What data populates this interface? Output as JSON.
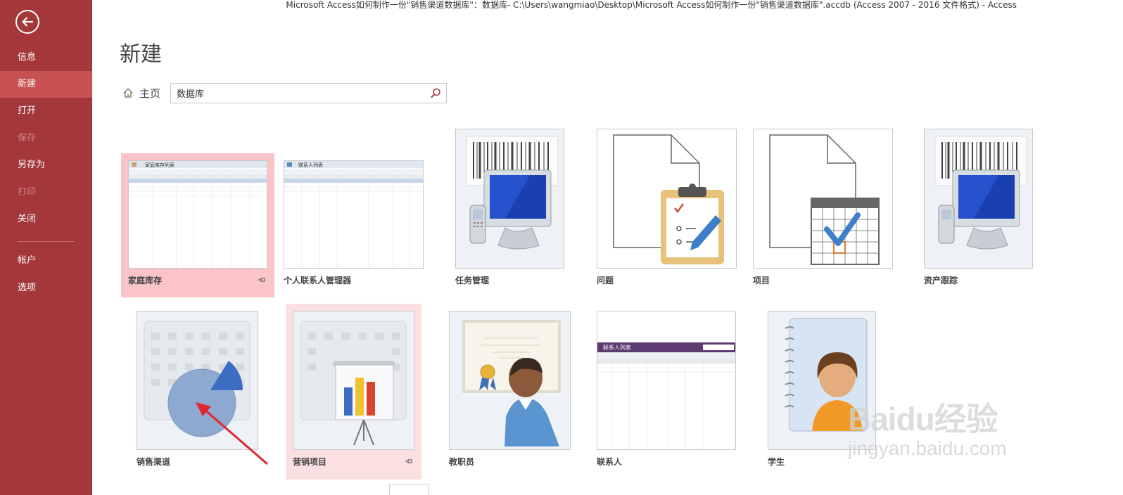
{
  "window": {
    "title": "Microsoft Access如何制作一份\"销售渠道数据库\"：数据库- C:\\Users\\wangmiao\\Desktop\\Microsoft Access如何制作一份\"销售渠道数据库\".accdb (Access 2007 - 2016 文件格式) - Access"
  },
  "sidebar": {
    "items": [
      {
        "label": "信息",
        "state": "normal"
      },
      {
        "label": "新建",
        "state": "active"
      },
      {
        "label": "打开",
        "state": "normal"
      },
      {
        "label": "保存",
        "state": "disabled"
      },
      {
        "label": "另存为",
        "state": "normal"
      },
      {
        "label": "打印",
        "state": "disabled"
      },
      {
        "label": "关闭",
        "state": "normal"
      },
      {
        "label": "帐户",
        "state": "normal"
      },
      {
        "label": "选项",
        "state": "normal"
      }
    ],
    "back_icon": "back-arrow-icon",
    "bg_color": "#a4373a",
    "active_color": "#c75153"
  },
  "page": {
    "title": "新建"
  },
  "search": {
    "home_label": "主页",
    "value": "数据库",
    "icon": "search-icon"
  },
  "templates": [
    {
      "label": "家庭库存",
      "thumb_title": "家庭库存列表",
      "selected": true,
      "pinned": true
    },
    {
      "label": "个人联系人管理器",
      "thumb_title": "联系人列表"
    },
    {
      "label": "任务管理"
    },
    {
      "label": "问题"
    },
    {
      "label": "项目"
    },
    {
      "label": "资产跟踪"
    },
    {
      "label": "销售渠道"
    },
    {
      "label": "营销项目",
      "hover": true,
      "pinned": true
    },
    {
      "label": "教职员"
    },
    {
      "label": "联系人",
      "thumb_title": "联系人列表"
    },
    {
      "label": "学生"
    }
  ],
  "watermark": {
    "main": "Baidu经验",
    "sub": "jingyan.baidu.com"
  }
}
